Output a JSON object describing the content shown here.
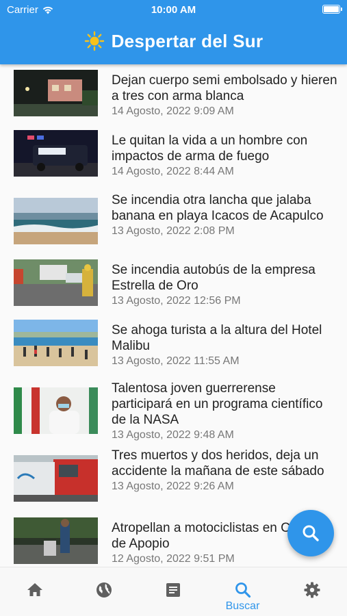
{
  "status_bar": {
    "carrier": "Carrier",
    "time": "10:00 AM"
  },
  "app": {
    "title": "Despertar del Sur",
    "logo_icon": "sun-icon"
  },
  "articles": [
    {
      "headline": "Dejan cuerpo semi embolsado y hieren a tres con arma blanca",
      "date": "14 Agosto, 2022 9:09 AM"
    },
    {
      "headline": "Le quitan la vida a un hombre con impactos de arma de fuego",
      "date": "14 Agosto, 2022 8:44 AM"
    },
    {
      "headline": "Se incendia otra lancha que jalaba banana en playa Icacos de Acapulco",
      "date": "13 Agosto, 2022 2:08 PM"
    },
    {
      "headline": "Se incendia autobús de la empresa Estrella de Oro",
      "date": "13 Agosto, 2022 12:56 PM"
    },
    {
      "headline": "Se ahoga turista a la altura del Hotel Malibu",
      "date": "13 Agosto, 2022 11:55 AM"
    },
    {
      "headline": "Talentosa joven guerrerense participará en un programa científico de la NASA",
      "date": "13 Agosto, 2022 9:48 AM"
    },
    {
      "headline": "Tres muertos y dos heridos, deja un accidente la mañana de este sábado",
      "date": "13 Agosto, 2022 9:26 AM"
    },
    {
      "headline": "Atropellan a motociclistas en Curvas de Apopio",
      "date": "12 Agosto, 2022 9:51 PM"
    }
  ],
  "tabs": [
    {
      "icon": "home-icon",
      "label": ""
    },
    {
      "icon": "globe-icon",
      "label": ""
    },
    {
      "icon": "article-icon",
      "label": ""
    },
    {
      "icon": "search-icon",
      "label": "Buscar",
      "active": true
    },
    {
      "icon": "gear-icon",
      "label": ""
    }
  ],
  "colors": {
    "primary": "#2f95ea",
    "tab_inactive": "#5f5f5f",
    "text": "#222222",
    "date": "#777777"
  }
}
